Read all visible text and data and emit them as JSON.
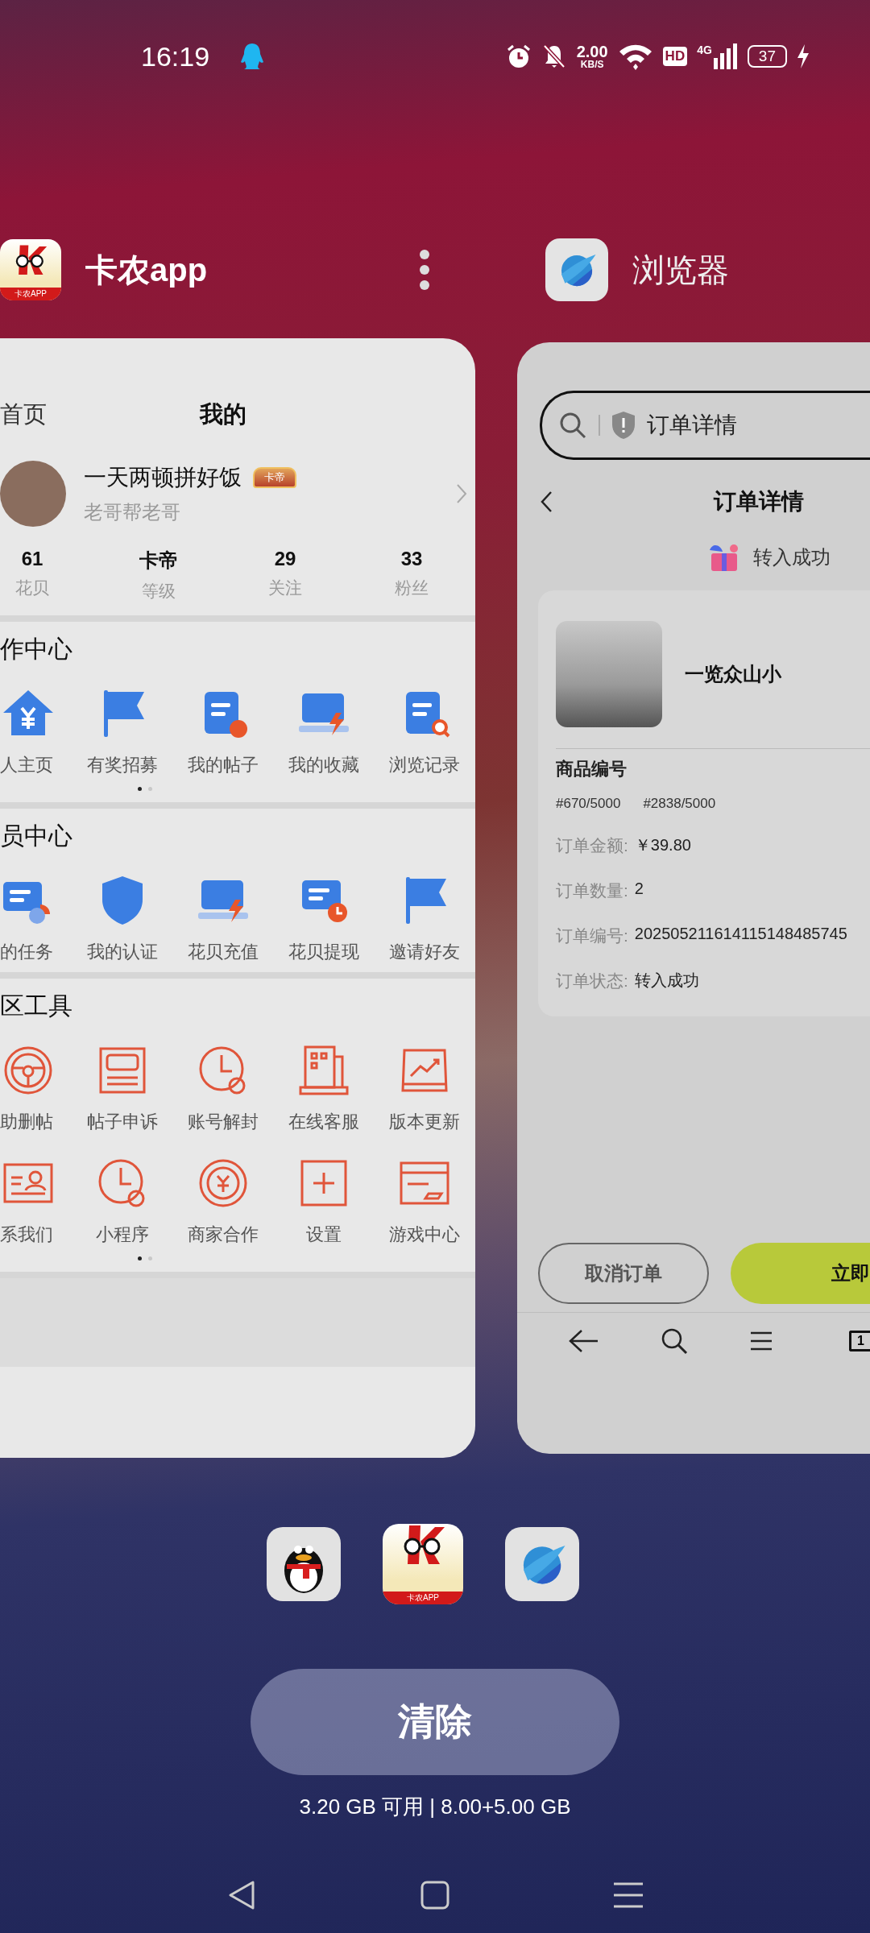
{
  "status_bar": {
    "time": "16:19",
    "speed_value": "2.00",
    "speed_unit": "KB/S",
    "hd": "HD",
    "network": "4G",
    "battery": "37"
  },
  "app_headers": [
    {
      "title": "卡农app",
      "kind": "forum",
      "icon_text": "卡农APP"
    },
    {
      "title": "浏览器",
      "kind": "browser"
    }
  ],
  "forum_card": {
    "tabs": [
      {
        "label": "首页",
        "selected": false
      },
      {
        "label": "我的",
        "selected": true
      }
    ],
    "profile": {
      "name": "一天两顿拼好饭",
      "badge": "卡帝",
      "subtitle": "老哥帮老哥"
    },
    "stats": [
      {
        "value": "61",
        "label": "花贝"
      },
      {
        "value": "卡帝",
        "label": "等级"
      },
      {
        "value": "29",
        "label": "关注"
      },
      {
        "value": "33",
        "label": "粉丝"
      }
    ],
    "sections": [
      {
        "title": "作中心",
        "kind": "filled",
        "items": [
          "人主页",
          "有奖招募",
          "我的帖子",
          "我的收藏",
          "浏览记录"
        ],
        "pages": [
          {
            "selected": true
          },
          {
            "selected": false
          }
        ]
      },
      {
        "title": "员中心",
        "kind": "filled",
        "items": [
          "的任务",
          "我的认证",
          "花贝充值",
          "花贝提现",
          "邀请好友"
        ]
      },
      {
        "title": "区工具",
        "kind": "outline",
        "items": [
          "助删帖",
          "帖子申诉",
          "账号解封",
          "在线客服",
          "版本更新",
          "系我们",
          "小程序",
          "商家合作",
          "设置",
          "游戏中心"
        ],
        "pages": [
          {
            "selected": true
          },
          {
            "selected": false
          }
        ]
      }
    ]
  },
  "browser_card": {
    "search": {
      "value": "订单详情"
    },
    "page_title": "订单详情",
    "status": "转入成功",
    "product": {
      "name": "一览众山小"
    },
    "code_label": "商品编号",
    "codes": [
      "#670/5000",
      "#2838/5000"
    ],
    "fields": [
      {
        "label": "订单金额:",
        "value": "￥39.80"
      },
      {
        "label": "订单数量:",
        "value": "2"
      },
      {
        "label": "订单编号:",
        "value": "202505211614115148485745"
      },
      {
        "label": "订单状态:",
        "value": "转入成功"
      }
    ],
    "buttons": [
      {
        "label": "取消订单",
        "kind": "outline"
      },
      {
        "label": "立即",
        "kind": "primary"
      }
    ],
    "tab_count": "1"
  },
  "dock": [
    {
      "kind": "qq"
    },
    {
      "kind": "forum",
      "icon_text": "卡农APP"
    },
    {
      "kind": "browser"
    }
  ],
  "clear_button": "清除",
  "memory": "3.20 GB 可用 | 8.00+5.00 GB"
}
